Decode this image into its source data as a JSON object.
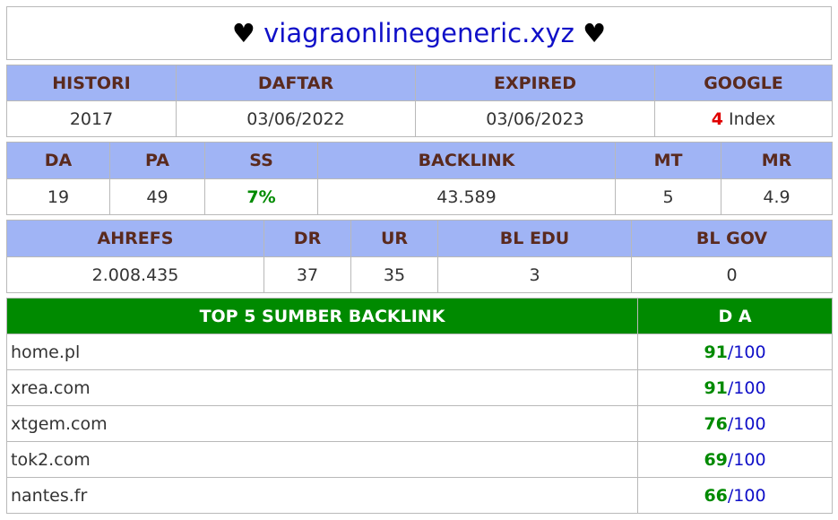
{
  "title": {
    "left_symbol": "♥",
    "domain": "viagraonlinegeneric.xyz",
    "right_symbol": "♥"
  },
  "table1": {
    "headers": [
      "HISTORI",
      "DAFTAR",
      "EXPIRED",
      "GOOGLE"
    ],
    "histori": "2017",
    "daftar": "03/06/2022",
    "expired": "03/06/2023",
    "google_count": "4",
    "google_label": "Index"
  },
  "table2": {
    "headers": [
      "DA",
      "PA",
      "SS",
      "BACKLINK",
      "MT",
      "MR"
    ],
    "da": "19",
    "pa": "49",
    "ss": "7%",
    "backlink": "43.589",
    "mt": "5",
    "mr": "4.9"
  },
  "table3": {
    "headers": [
      "AHREFS",
      "DR",
      "UR",
      "BL EDU",
      "BL GOV"
    ],
    "ahrefs": "2.008.435",
    "dr": "37",
    "ur": "35",
    "bl_edu": "3",
    "bl_gov": "0"
  },
  "top5": {
    "header_source": "TOP 5 SUMBER BACKLINK",
    "header_da": "D A",
    "rows": [
      {
        "source": "home.pl",
        "da": "91",
        "max": "/100"
      },
      {
        "source": "xrea.com",
        "da": "91",
        "max": "/100"
      },
      {
        "source": "xtgem.com",
        "da": "76",
        "max": "/100"
      },
      {
        "source": "tok2.com",
        "da": "69",
        "max": "/100"
      },
      {
        "source": "nantes.fr",
        "da": "66",
        "max": "/100"
      }
    ]
  },
  "colors": {
    "header_bg": "#a0b4f5",
    "header_text": "#5a2a1e",
    "green": "#008a00",
    "blue": "#1010c8",
    "red": "#e00000"
  }
}
